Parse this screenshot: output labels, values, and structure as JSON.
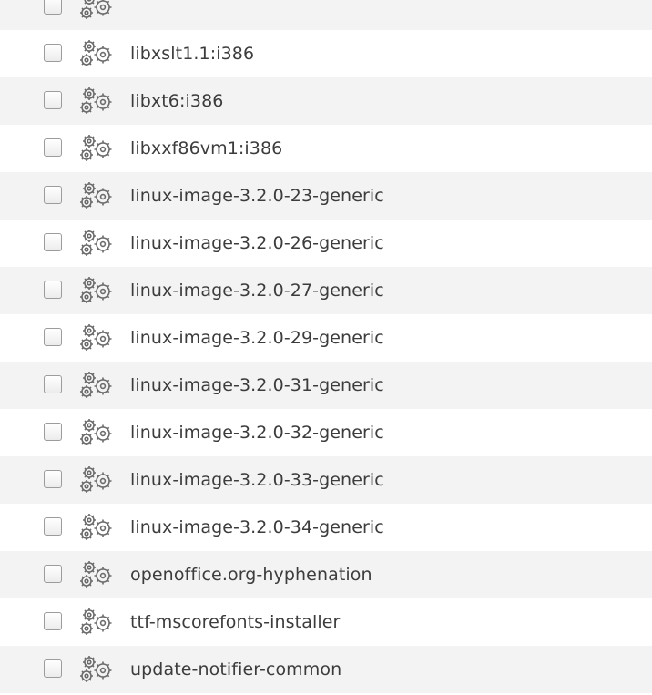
{
  "package_list": {
    "items": [
      {
        "name": ""
      },
      {
        "name": "libxslt1.1:i386"
      },
      {
        "name": "libxt6:i386"
      },
      {
        "name": "libxxf86vm1:i386"
      },
      {
        "name": "linux-image-3.2.0-23-generic"
      },
      {
        "name": "linux-image-3.2.0-26-generic"
      },
      {
        "name": "linux-image-3.2.0-27-generic"
      },
      {
        "name": "linux-image-3.2.0-29-generic"
      },
      {
        "name": "linux-image-3.2.0-31-generic"
      },
      {
        "name": "linux-image-3.2.0-32-generic"
      },
      {
        "name": "linux-image-3.2.0-33-generic"
      },
      {
        "name": "linux-image-3.2.0-34-generic"
      },
      {
        "name": "openoffice.org-hyphenation"
      },
      {
        "name": "ttf-mscorefonts-installer"
      },
      {
        "name": "update-notifier-common"
      }
    ]
  },
  "icons": {
    "package": "gears-icon",
    "checkbox": "unchecked"
  },
  "colors": {
    "row_alt_bg": "#f3f3f3",
    "text": "#3c3c3c",
    "checkbox_border": "#9c9c9c"
  }
}
